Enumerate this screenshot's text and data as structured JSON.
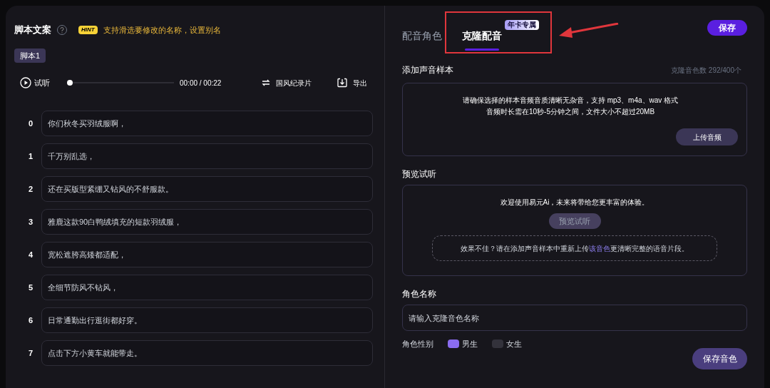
{
  "script_panel": {
    "title": "脚本文案",
    "hint_badge": "HINT",
    "hint": "支持滑选要修改的名称，设置别名",
    "script_tabs": [
      {
        "label": "脚本1",
        "selected": true
      }
    ],
    "player": {
      "play_label": "试听",
      "level": 0,
      "time": "00:00 / 00:22",
      "style_button": "国风纪录片",
      "export_button": "导出"
    },
    "lines": [
      {
        "index": "0",
        "text": "你们秋冬买羽绒服啊，"
      },
      {
        "index": "1",
        "text": "千万别乱选，"
      },
      {
        "index": "2",
        "text": "还在买版型紧绷又钻风的不舒服款。"
      },
      {
        "index": "3",
        "text": "雅鹿这款90白鸭绒填充的短款羽绒服，"
      },
      {
        "index": "4",
        "text": "宽松遮胯高矮都适配，"
      },
      {
        "index": "5",
        "text": "全细节防风不钻风，"
      },
      {
        "index": "6",
        "text": "日常通勤出行逛街都好穿。"
      },
      {
        "index": "7",
        "text": "点击下方小黄车就能带走。"
      }
    ]
  },
  "voice_panel": {
    "tabs": [
      {
        "label": "配音角色",
        "selected": false
      },
      {
        "label": "克隆配音",
        "selected": true,
        "badge": "年卡专属"
      }
    ],
    "save_button": "保存",
    "sample": {
      "title": "添加声音样本",
      "count": "克隆音色数 292/400个",
      "lines": [
        "请确保选择的样本音频音质清晰无杂音，支持 mp3、m4a、wav 格式",
        "音频时长需在10秒-5分钟之间，文件大小不超过20MB"
      ],
      "upload_button": "上传音频"
    },
    "preview": {
      "title": "预览试听",
      "message": "欢迎使用易元Ai，未来将带给您更丰富的体验。",
      "preview_button": "预览试听",
      "note": "效果不佳？请在添加声音样本中重新上传**该音色**更清晰完整的语音片段。"
    },
    "name": {
      "title": "角色名称",
      "placeholder": "请输入克隆音色名称"
    },
    "gender": {
      "title": "角色性别",
      "options": [
        {
          "label": "男生",
          "selected": true
        },
        {
          "label": "女生",
          "selected": false
        }
      ]
    },
    "save_voice_button": "保存音色"
  }
}
